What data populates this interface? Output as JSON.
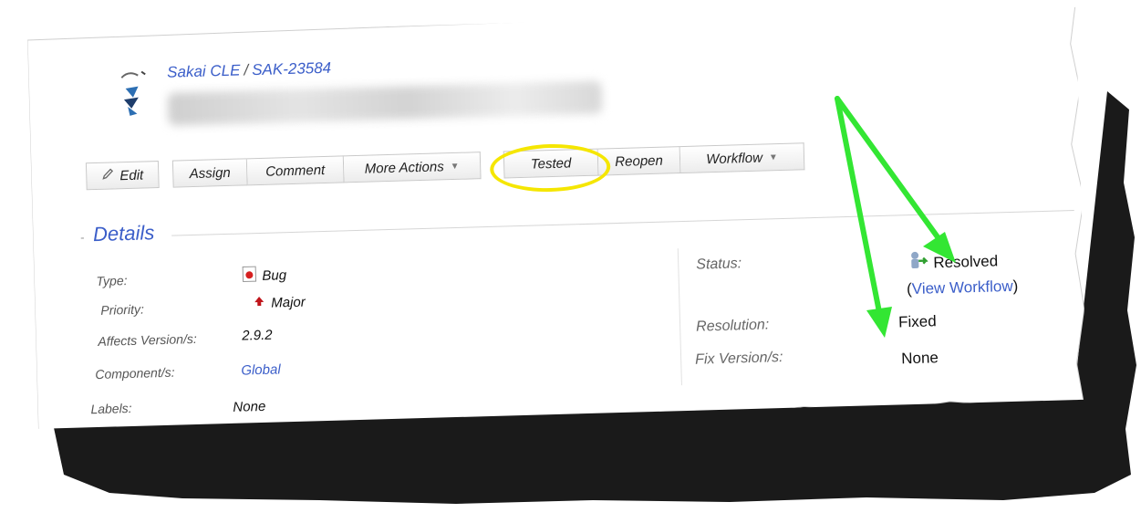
{
  "breadcrumb": {
    "project": "Sakai CLE",
    "separator": "/",
    "issue_key": "SAK-23584"
  },
  "toolbar": {
    "edit": "Edit",
    "assign": "Assign",
    "comment": "Comment",
    "more_actions": "More Actions",
    "tested": "Tested",
    "reopen": "Reopen",
    "workflow": "Workflow"
  },
  "details": {
    "toggle": "-",
    "title": "Details",
    "fields": {
      "type": {
        "label": "Type:",
        "value": "Bug"
      },
      "priority": {
        "label": "Priority:",
        "value": "Major"
      },
      "affects_version": {
        "label": "Affects Version/s:",
        "value": "2.9.2"
      },
      "component": {
        "label": "Component/s:",
        "value": "Global"
      },
      "labels": {
        "label": "Labels:",
        "value": "None"
      },
      "status": {
        "label": "Status:",
        "value": "Resolved",
        "paren_open": "(",
        "link": "View Workflow",
        "paren_close": ")"
      },
      "resolution": {
        "label": "Resolution:",
        "value": "Fixed"
      },
      "fix_version": {
        "label": "Fix Version/s:",
        "value": "None"
      }
    }
  },
  "colors": {
    "link": "#3b5ec9",
    "highlight_circle": "#f5e600",
    "arrow": "#33e633",
    "shadow": "#1a1a1a"
  },
  "icons": {
    "logo": "sakai-logo-icon",
    "type": "bug-icon",
    "priority": "major-priority-arrow-icon",
    "status": "resolved-status-icon",
    "edit": "pencil-icon",
    "caret": "chevron-down-icon"
  }
}
